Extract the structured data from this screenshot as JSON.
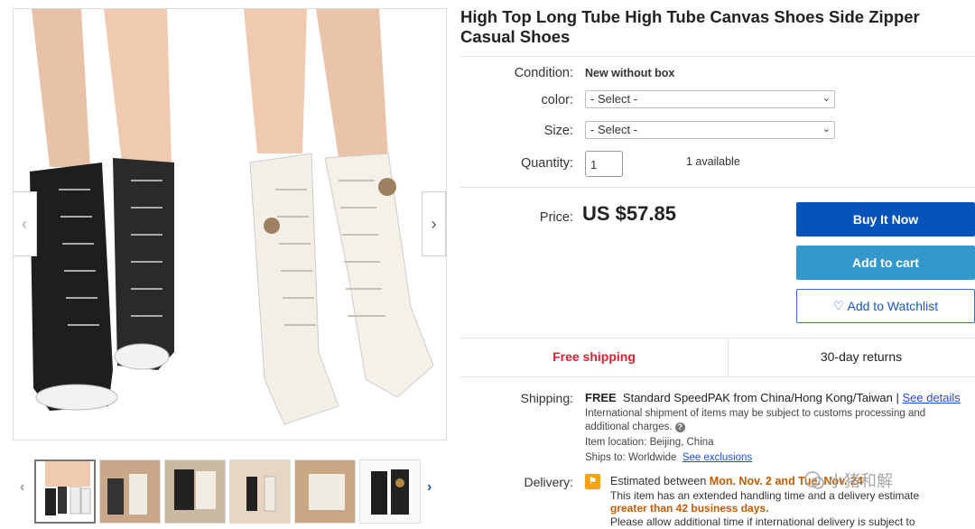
{
  "product": {
    "title": "High Top Long Tube High Tube Canvas Shoes Side Zipper Casual Shoes",
    "condition_label": "Condition:",
    "condition_value": "New without box",
    "color_label": "color:",
    "color_value": "- Select -",
    "size_label": "Size:",
    "size_value": "- Select -",
    "quantity_label": "Quantity:",
    "quantity_value": "1",
    "available": "1 available",
    "price_label": "Price:",
    "price": "US $57.85"
  },
  "actions": {
    "buy_now": "Buy It Now",
    "add_to_cart": "Add to cart",
    "watchlist": "Add to Watchlist"
  },
  "perks": {
    "free_shipping": "Free shipping",
    "returns": "30-day returns"
  },
  "shipping": {
    "label": "Shipping:",
    "free": "FREE",
    "method": "Standard SpeedPAK from China/Hong Kong/Taiwan |",
    "see_details": "See details",
    "intl_note_line1": "International shipment of items may be subject to customs processing and",
    "intl_note_line2": "additional charges.",
    "location": "Item location: Beijing, China",
    "ships_to": "Ships to: Worldwide",
    "see_exclusions": "See exclusions"
  },
  "delivery": {
    "label": "Delivery:",
    "estimated_prefix": "Estimated between",
    "estimated_dates": "Mon. Nov. 2 and Tue. Nov. 24",
    "handling_line": "This item has an extended handling time and a delivery estimate",
    "greater_than": "greater than 42 business days.",
    "allow_line": "Please allow additional time if international delivery is subject to"
  },
  "gallery": {
    "prev_arrow": "‹",
    "next_arrow": "›",
    "thumb_prev": "‹",
    "thumb_next": "›"
  },
  "watermark": "小猪和解",
  "colors": {
    "buy_now": "#0654ba",
    "add_to_cart": "#3498ca",
    "free_shipping": "#dd1e31",
    "link": "#1a55c2"
  }
}
